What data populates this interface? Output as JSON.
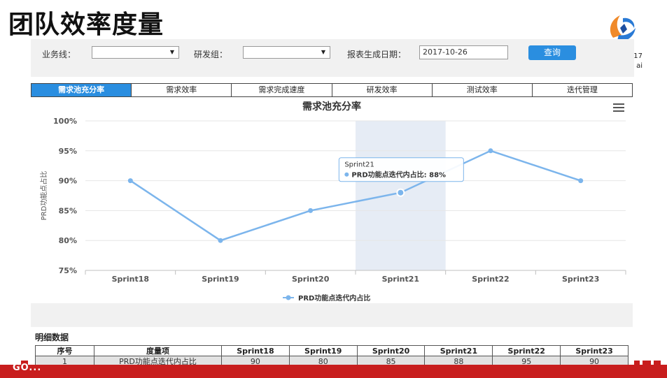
{
  "slide": {
    "title": "团队效率度量",
    "corner_text": "17 ai"
  },
  "filters": {
    "business_label": "业务线：",
    "business_value": "",
    "group_label": "研发组：",
    "group_value": "",
    "date_label": "报表生成日期：",
    "date_value": "2017-10-26",
    "query_button": "查询"
  },
  "tabs": [
    {
      "label": "需求池充分率",
      "active": true
    },
    {
      "label": "需求效率"
    },
    {
      "label": "需求完成速度"
    },
    {
      "label": "研发效率"
    },
    {
      "label": "测试效率"
    },
    {
      "label": "迭代管理"
    }
  ],
  "chart_data": {
    "type": "line",
    "title": "需求池充分率",
    "ylabel": "PRD功能点占比",
    "xlabel": "",
    "categories": [
      "Sprint18",
      "Sprint19",
      "Sprint20",
      "Sprint21",
      "Sprint22",
      "Sprint23"
    ],
    "series": [
      {
        "name": "PRD功能点迭代内占比",
        "values": [
          90,
          80,
          85,
          88,
          95,
          90
        ],
        "color": "#7cb5ec"
      }
    ],
    "ylim": [
      75,
      100
    ],
    "yticks": [
      "75%",
      "80%",
      "85%",
      "90%",
      "95%",
      "100%"
    ],
    "grid": true,
    "legend": "bottom-center",
    "tooltip": {
      "title": "Sprint21",
      "series": "PRD功能点迭代内占比",
      "value": "88%"
    },
    "highlight_index": 3
  },
  "detail": {
    "title": "明细数据",
    "headers": [
      "序号",
      "度量项",
      "Sprint18",
      "Sprint19",
      "Sprint20",
      "Sprint21",
      "Sprint22",
      "Sprint23"
    ],
    "rows": [
      [
        "1",
        "PRD功能点迭代内占比",
        "90",
        "80",
        "85",
        "88",
        "95",
        "90"
      ]
    ]
  },
  "footer": {
    "text": "GO..."
  },
  "colors": {
    "accent": "#2a8ee0",
    "series": "#7cb5ec",
    "footer": "#c81e1e"
  }
}
